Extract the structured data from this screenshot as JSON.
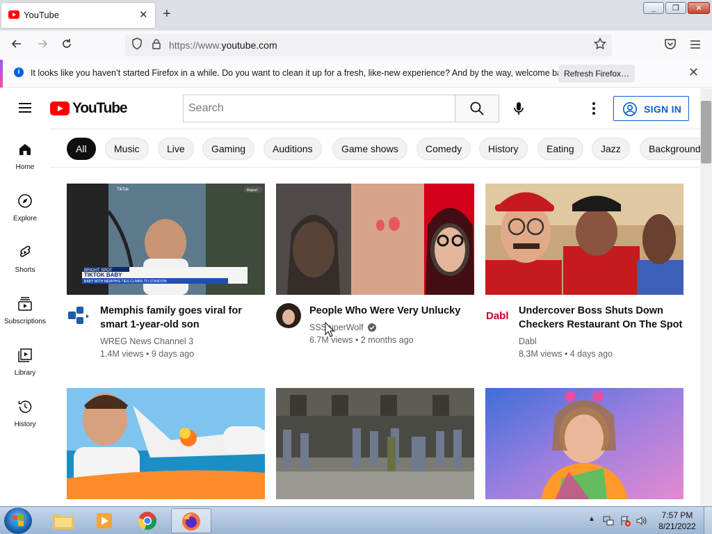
{
  "browser": {
    "tab": {
      "title": "YouTube",
      "favicon": "youtube-icon"
    },
    "url": {
      "prefix": "https://www.",
      "domain": "youtube.com"
    },
    "notification": {
      "message": "It looks like you haven’t started Firefox in a while. Do you want to clean it up for a fresh, like-new experience? And by the way, welcome back!",
      "button": "Refresh Firefox…"
    }
  },
  "youtube": {
    "logo_text": "YouTube",
    "search": {
      "placeholder": "Search"
    },
    "sign_in": "SIGN IN",
    "chips": [
      "All",
      "Music",
      "Live",
      "Gaming",
      "Auditions",
      "Game shows",
      "Comedy",
      "History",
      "Eating",
      "Jazz",
      "Background"
    ],
    "guide": [
      {
        "label": "Home",
        "icon": "home-icon"
      },
      {
        "label": "Explore",
        "icon": "compass-icon"
      },
      {
        "label": "Shorts",
        "icon": "shorts-icon"
      },
      {
        "label": "Subscriptions",
        "icon": "subscriptions-icon"
      },
      {
        "label": "Library",
        "icon": "library-icon"
      },
      {
        "label": "History",
        "icon": "history-icon"
      }
    ],
    "videos": [
      {
        "title": "Memphis family goes viral for smart 1-year-old son",
        "channel": "WREG News Channel 3",
        "views": "1.4M views",
        "age": "9 days ago",
        "verified": false,
        "thumb_text": {
          "tiktok": "TikTok",
          "report": "Report",
          "brand": "BRIGHT SPOT",
          "headline": "TIKTOK BABY",
          "sub": "BABY WITH MEMPHIS TIES CLIMBS TO STARDOM"
        }
      },
      {
        "title": "People Who Were Very Unlucky",
        "channel": "SSSniperWolf",
        "views": "6.7M views",
        "age": "2 months ago",
        "verified": true
      },
      {
        "title": "Undercover Boss Shuts Down Checkers Restaurant On The Spot",
        "channel": "Dabl",
        "views": "8.3M views",
        "age": "4 days ago",
        "verified": false,
        "avatar_text": "Dabl"
      },
      {
        "title": "",
        "channel": "",
        "views": "",
        "age": ""
      },
      {
        "title": "",
        "channel": "",
        "views": "",
        "age": ""
      },
      {
        "title": "",
        "channel": "",
        "views": "",
        "age": ""
      }
    ]
  },
  "taskbar": {
    "time": "7:57 PM",
    "date": "8/21/2022"
  },
  "colors": {
    "youtube_red": "#ff0000",
    "signin_blue": "#065fd4",
    "chip_active": "#0f0f0f"
  }
}
